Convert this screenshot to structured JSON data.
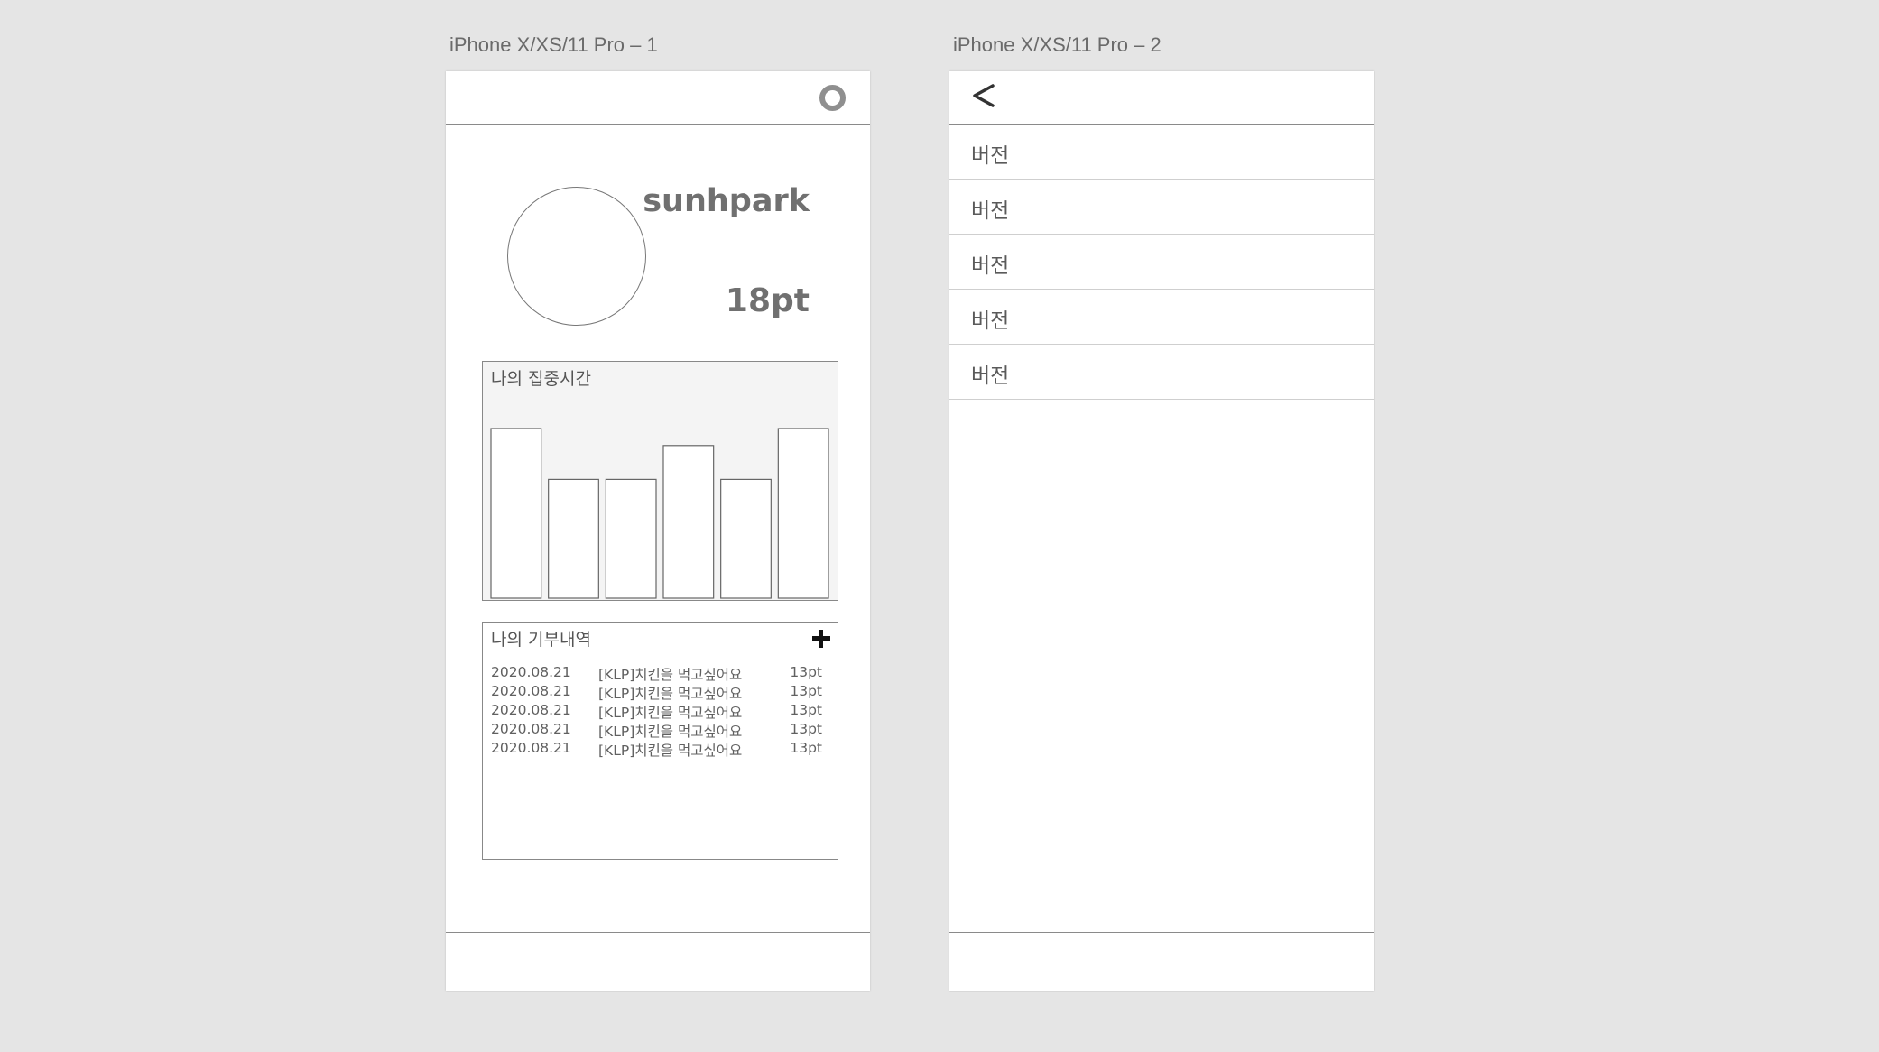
{
  "artboards": [
    {
      "label": "iPhone X/XS/11 Pro – 1"
    },
    {
      "label": "iPhone X/XS/11 Pro – 2"
    }
  ],
  "profile": {
    "username": "sunhpark",
    "points": "18pt",
    "settings_icon": "gear-icon"
  },
  "focus": {
    "title": "나의 집중시간",
    "chart_data": {
      "type": "bar",
      "title": "나의 집중시간",
      "categories": [],
      "values": [
        100,
        70,
        70,
        90,
        70,
        100
      ],
      "ylim": [
        0,
        100
      ],
      "grid": false,
      "colors": {
        "fill": "#ffffff",
        "stroke": "#666666",
        "background": "#f4f4f4"
      }
    }
  },
  "donations": {
    "title": "나의 기부내역",
    "add_icon": "plus-icon",
    "rows": [
      {
        "date": "2020.08.21",
        "title": "[KLP]치킨을 먹고싶어요",
        "points": "13pt"
      },
      {
        "date": "2020.08.21",
        "title": "[KLP]치킨을 먹고싶어요",
        "points": "13pt"
      },
      {
        "date": "2020.08.21",
        "title": "[KLP]치킨을 먹고싶어요",
        "points": "13pt"
      },
      {
        "date": "2020.08.21",
        "title": "[KLP]치킨을 먹고싶어요",
        "points": "13pt"
      },
      {
        "date": "2020.08.21",
        "title": "[KLP]치킨을 먹고싶어요",
        "points": "13pt"
      }
    ]
  },
  "settings": {
    "back_icon": "chevron-left-icon",
    "items": [
      {
        "label": "버전"
      },
      {
        "label": "버전"
      },
      {
        "label": "버전"
      },
      {
        "label": "버전"
      },
      {
        "label": "버전"
      }
    ]
  }
}
